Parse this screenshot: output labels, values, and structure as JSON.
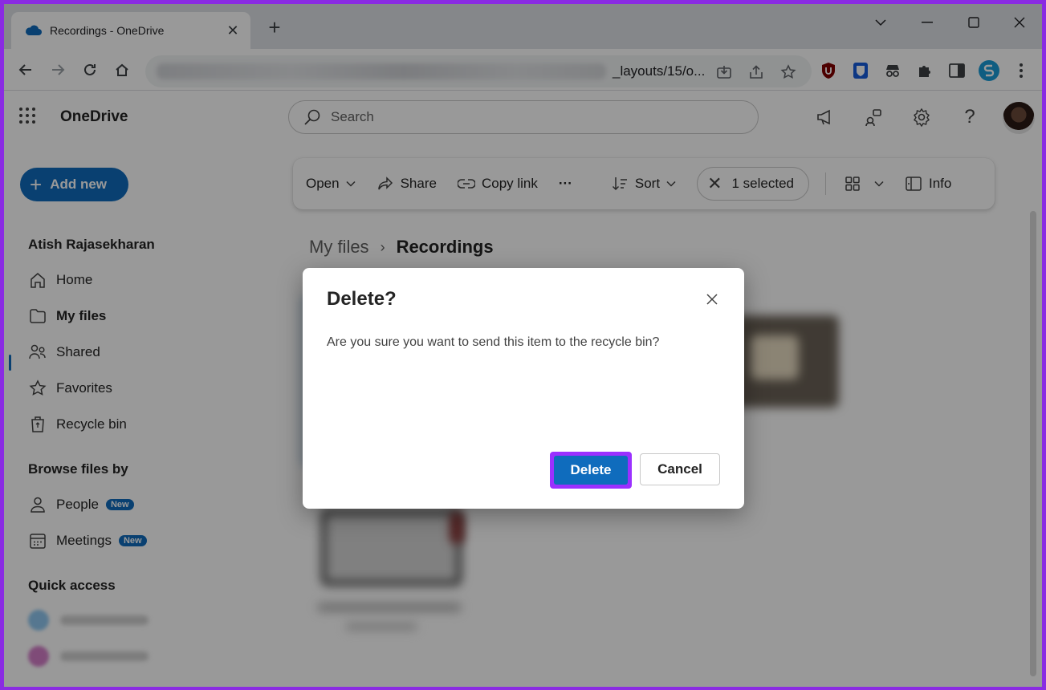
{
  "browser": {
    "tab_title": "Recordings - OneDrive",
    "tab_close": "✕",
    "new_tab": "+",
    "url_visible_text": "_layouts/15/o..."
  },
  "app": {
    "name": "OneDrive",
    "search_placeholder": "Search"
  },
  "sidebar": {
    "add_new_plus": "+",
    "add_new_label": "Add new",
    "user_name": "Atish Rajasekharan",
    "items": [
      {
        "label": "Home",
        "icon": "home-icon"
      },
      {
        "label": "My files",
        "icon": "folder-icon",
        "active": true
      },
      {
        "label": "Shared",
        "icon": "people-icon"
      },
      {
        "label": "Favorites",
        "icon": "star-icon"
      },
      {
        "label": "Recycle bin",
        "icon": "recycle-bin-icon"
      }
    ],
    "browse_heading": "Browse files by",
    "browse_items": [
      {
        "label": "People",
        "badge": "New",
        "icon": "person-icon"
      },
      {
        "label": "Meetings",
        "badge": "New",
        "icon": "calendar-icon"
      }
    ],
    "quick_access_heading": "Quick access"
  },
  "commandbar": {
    "open": "Open",
    "share": "Share",
    "copy_link": "Copy link",
    "more": "···",
    "sort": "Sort",
    "selected_close": "✕",
    "selected": "1 selected",
    "info": "Info"
  },
  "breadcrumb": {
    "parent": "My files",
    "separator": "›",
    "current": "Recordings"
  },
  "dialog": {
    "title": "Delete?",
    "message": "Are you sure you want to send this item to the recycle bin?",
    "delete_label": "Delete",
    "cancel_label": "Cancel"
  },
  "colors": {
    "accent": "#0f6cbd",
    "highlight_border": "#9b30ff"
  }
}
